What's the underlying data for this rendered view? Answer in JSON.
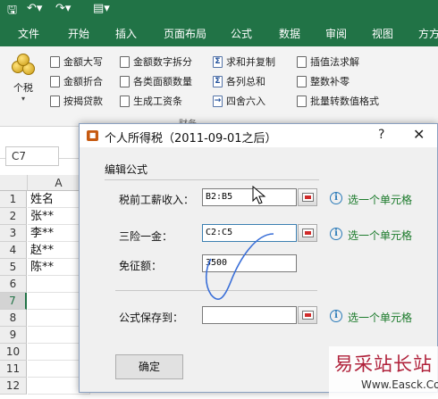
{
  "colors": {
    "brand": "#217346",
    "hint": "#1a7a2a",
    "accent_red": "#d02b2b"
  },
  "quick_access": [
    "save-icon",
    "undo-icon",
    "redo-icon",
    "customize-icon"
  ],
  "tabs": [
    "文件",
    "开始",
    "插入",
    "页面布局",
    "公式",
    "数据",
    "审阅",
    "视图",
    "方方"
  ],
  "ribbon": {
    "big_button_label": "个税",
    "col1": [
      "金额大写",
      "金额折合",
      "按揭贷款"
    ],
    "col2": [
      "金额数字拆分",
      "各类面额数量",
      "生成工资条"
    ],
    "col3": [
      "求和并复制",
      "各列总和",
      "四舍六入"
    ],
    "col4": [
      "插值法求解",
      "整数补零",
      "批量转数值格式"
    ],
    "group_label": "财务"
  },
  "namebox": "C7",
  "sheet": {
    "col_header": "A",
    "rows": [
      "1",
      "2",
      "3",
      "4",
      "5",
      "6",
      "7",
      "8",
      "9",
      "10",
      "11",
      "12"
    ],
    "cells": [
      "姓名",
      "张**",
      "李**",
      "赵**",
      "陈**"
    ]
  },
  "dialog": {
    "title": "个人所得税（2011-09-01之后）",
    "help": "?",
    "close": "✕",
    "section": "编辑公式",
    "fields": [
      {
        "label": "税前工薪收入：",
        "value": "B2:B5",
        "hint": "选一个单元格"
      },
      {
        "label": "三险一金：",
        "value": "C2:C5",
        "hint": "选一个单元格"
      },
      {
        "label": "免征额：",
        "value": "3500"
      },
      {
        "label": "公式保存到：",
        "value": "",
        "hint": "选一个单元格"
      }
    ],
    "ok": "确定"
  },
  "watermark": {
    "cn": "易采站长站",
    "url": "Www.Easck.Com"
  }
}
